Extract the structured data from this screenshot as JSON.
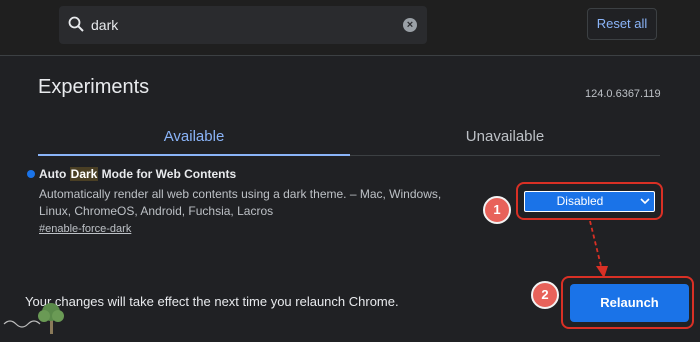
{
  "search": {
    "value": "dark"
  },
  "header": {
    "reset_label": "Reset all"
  },
  "page": {
    "title": "Experiments",
    "version": "124.0.6367.119"
  },
  "tabs": [
    {
      "label": "Available",
      "active": true
    },
    {
      "label": "Unavailable",
      "active": false
    }
  ],
  "experiment": {
    "title_pre": "Auto ",
    "title_highlight": "Dark",
    "title_post": " Mode for Web Contents",
    "description": "Automatically render all web contents using a dark theme. – Mac, Windows, Linux, ChromeOS, Android, Fuchsia, Lacros",
    "link": "#enable-force-dark",
    "select_value": "Disabled"
  },
  "footer": {
    "notice": "Your changes will take effect the next time you relaunch Chrome.",
    "relaunch_label": "Relaunch"
  },
  "annotations": {
    "step1": "1",
    "step2": "2"
  },
  "colors": {
    "accent": "#8ab4f8",
    "button": "#1a73e8",
    "annotation_red": "#d93025",
    "badge": "#e8625a"
  },
  "icons": [
    "search-icon",
    "clear-icon",
    "chevron-down-icon",
    "arrow-icon"
  ]
}
